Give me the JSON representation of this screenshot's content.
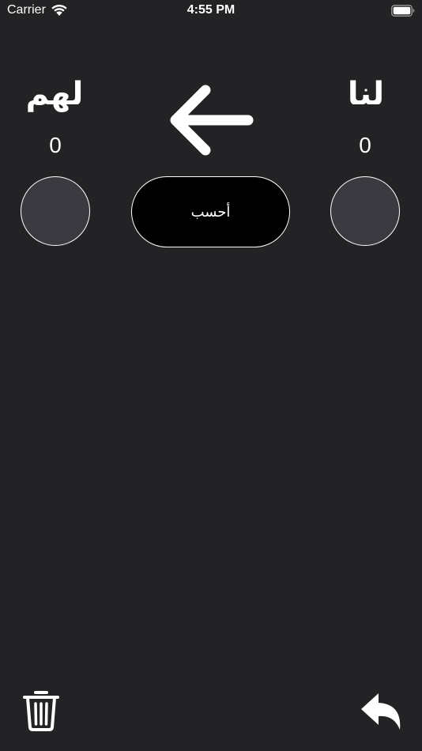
{
  "status_bar": {
    "carrier": "Carrier",
    "time": "4:55 PM"
  },
  "teams": {
    "them": {
      "name": "لهم",
      "score": "0"
    },
    "us": {
      "name": "لنا",
      "score": "0"
    }
  },
  "actions": {
    "calculate_label": "أحسب"
  },
  "icons": {
    "direction": "arrow-left-icon",
    "delete": "trash-icon",
    "undo": "undo-icon"
  },
  "colors": {
    "background": "#232325",
    "circle_fill": "#3a3a40",
    "button_fill": "#000000",
    "foreground": "#ffffff"
  }
}
